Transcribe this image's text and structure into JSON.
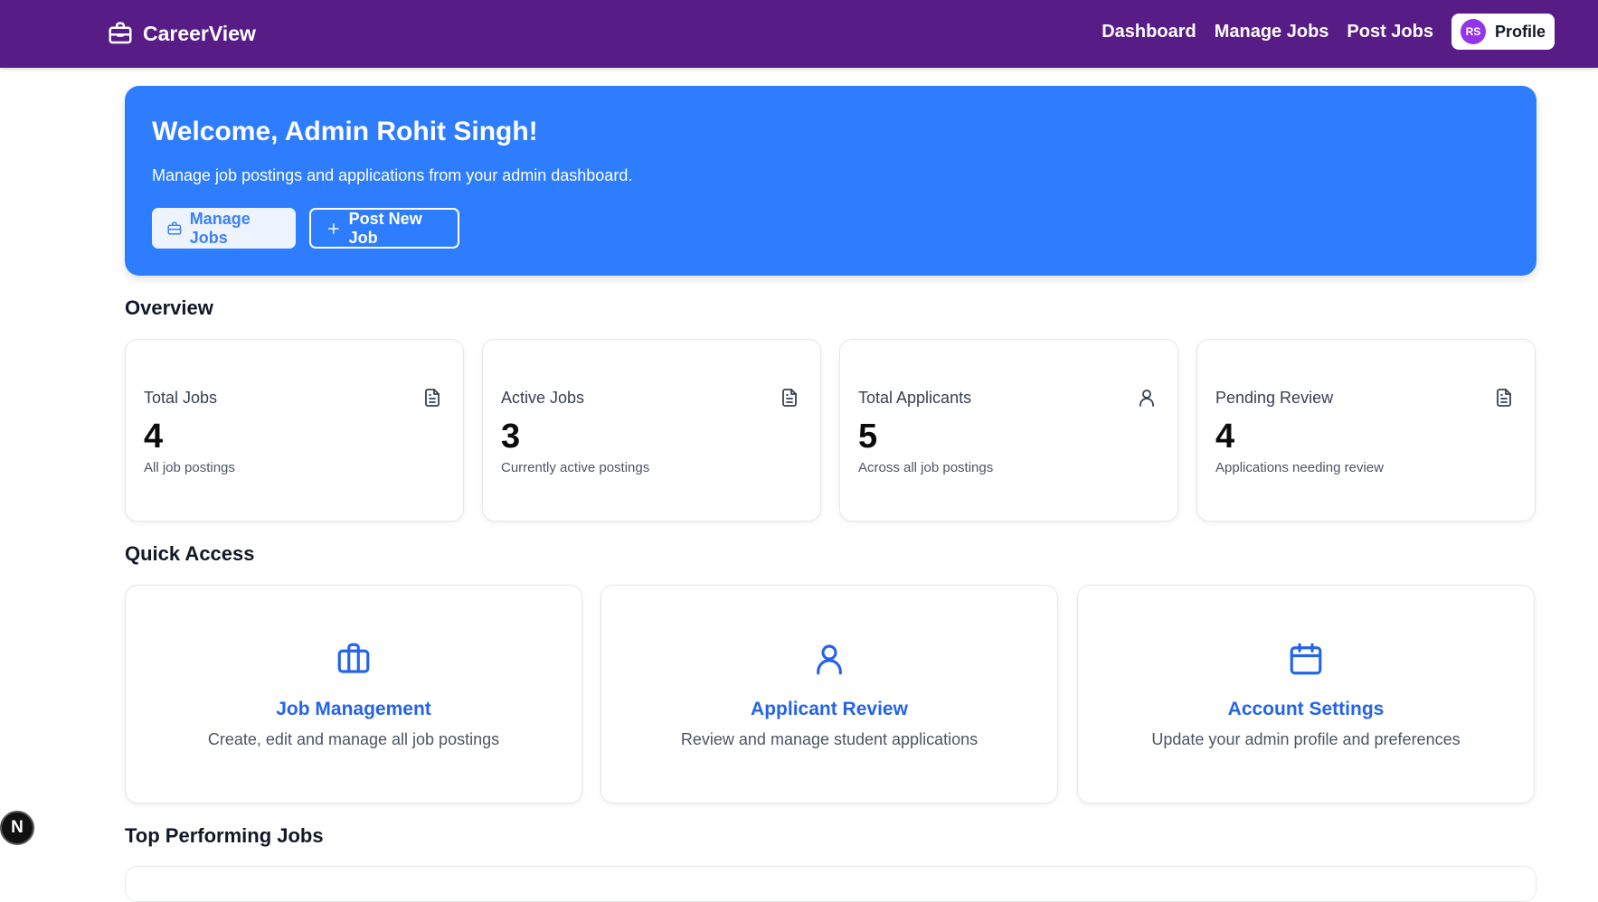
{
  "navbar": {
    "brand": "CareerView",
    "links": [
      "Dashboard",
      "Manage Jobs",
      "Post Jobs"
    ],
    "avatar_initials": "RS",
    "profile_label": "Profile"
  },
  "hero": {
    "title": "Welcome, Admin Rohit Singh!",
    "subtitle": "Manage job postings and applications from your admin dashboard.",
    "manage_button": "Manage Jobs",
    "post_button": "Post New Job"
  },
  "overview": {
    "title": "Overview",
    "cards": [
      {
        "label": "Total Jobs",
        "value": "4",
        "desc": "All job postings",
        "icon": "document-icon"
      },
      {
        "label": "Active Jobs",
        "value": "3",
        "desc": "Currently active postings",
        "icon": "document-icon"
      },
      {
        "label": "Total Applicants",
        "value": "5",
        "desc": "Across all job postings",
        "icon": "user-icon"
      },
      {
        "label": "Pending Review",
        "value": "4",
        "desc": "Applications needing review",
        "icon": "document-icon"
      }
    ]
  },
  "quick_access": {
    "title": "Quick Access",
    "cards": [
      {
        "title": "Job Management",
        "desc": "Create, edit and manage all job postings",
        "icon": "briefcase-icon"
      },
      {
        "title": "Applicant Review",
        "desc": "Review and manage student applications",
        "icon": "user-icon"
      },
      {
        "title": "Account Settings",
        "desc": "Update your admin profile and preferences",
        "icon": "calendar-icon"
      }
    ]
  },
  "top_jobs": {
    "title": "Top Performing Jobs"
  },
  "dev_badge": "N",
  "colors": {
    "navbar": "#581c87",
    "hero": "#2e7dff",
    "accent": "#2563eb",
    "avatar": "#9333ea"
  }
}
